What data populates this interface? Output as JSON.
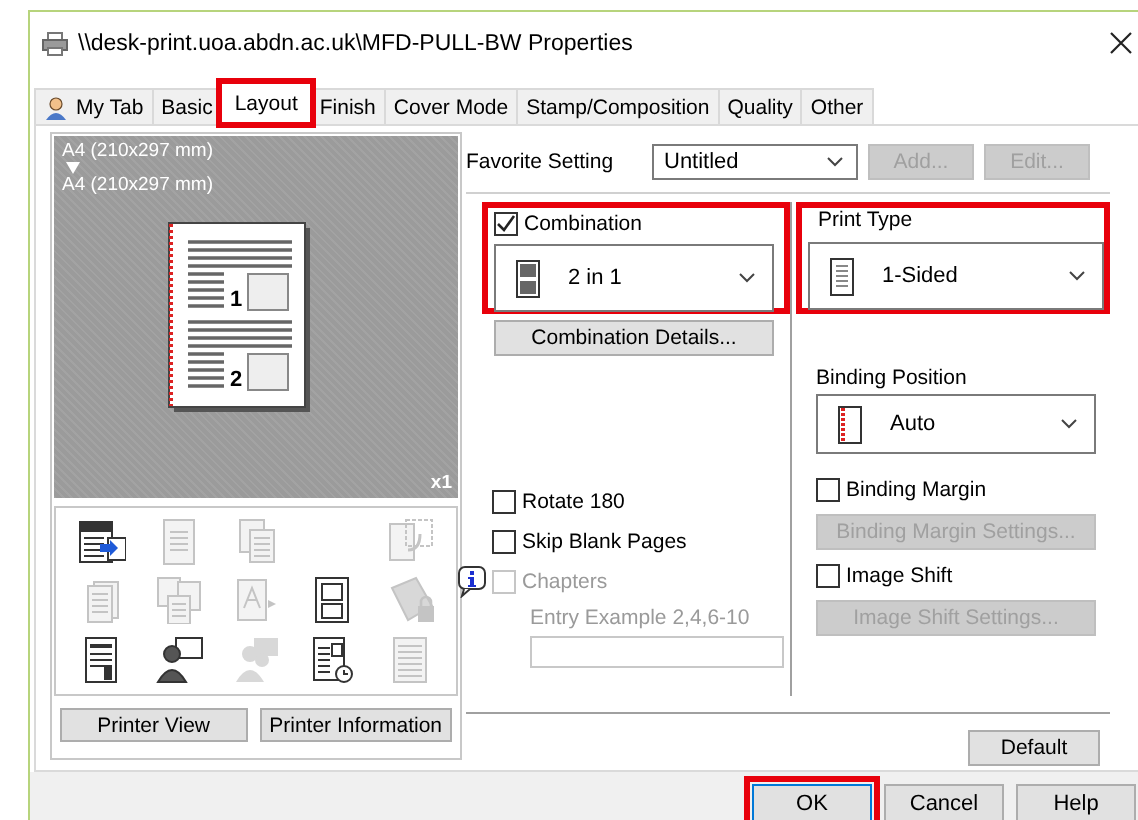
{
  "window": {
    "title": "\\\\desk-print.uoa.abdn.ac.uk\\MFD-PULL-BW Properties"
  },
  "tabs": [
    {
      "label": "My Tab",
      "has_icon": true,
      "selected": false,
      "highlighted": false
    },
    {
      "label": "Basic",
      "has_icon": false,
      "selected": false,
      "highlighted": false
    },
    {
      "label": "Layout",
      "has_icon": false,
      "selected": true,
      "highlighted": true
    },
    {
      "label": "Finish",
      "has_icon": false,
      "selected": false,
      "highlighted": false
    },
    {
      "label": "Cover Mode",
      "has_icon": false,
      "selected": false,
      "highlighted": false
    },
    {
      "label": "Stamp/Composition",
      "has_icon": false,
      "selected": false,
      "highlighted": false
    },
    {
      "label": "Quality",
      "has_icon": false,
      "selected": false,
      "highlighted": false
    },
    {
      "label": "Other",
      "has_icon": false,
      "selected": false,
      "highlighted": false
    }
  ],
  "preview": {
    "original_size": "A4 (210x297 mm)",
    "output_size": "A4 (210x297 mm)",
    "page_numbers": [
      "1",
      "2"
    ],
    "copies": "x1"
  },
  "function_icons": [
    {
      "kind": "device",
      "disabled": false
    },
    {
      "kind": "booklet",
      "disabled": true
    },
    {
      "kind": "pages",
      "disabled": true
    },
    {
      "kind": "spacer"
    },
    {
      "kind": "rotate",
      "disabled": true
    },
    {
      "kind": "stack",
      "disabled": true
    },
    {
      "kind": "multi",
      "disabled": true
    },
    {
      "kind": "font",
      "disabled": true
    },
    {
      "kind": "form",
      "disabled": false
    },
    {
      "kind": "lock",
      "disabled": true
    },
    {
      "kind": "report",
      "disabled": false
    },
    {
      "kind": "user",
      "disabled": false
    },
    {
      "kind": "users",
      "disabled": true
    },
    {
      "kind": "clock",
      "disabled": false
    },
    {
      "kind": "lines",
      "disabled": true
    }
  ],
  "preview_buttons": [
    {
      "label": "Printer View"
    },
    {
      "label": "Printer Information"
    }
  ],
  "favorite": {
    "label": "Favorite Setting",
    "value": "Untitled",
    "buttons": [
      {
        "label": "Add...",
        "disabled": true
      },
      {
        "label": "Edit...",
        "disabled": true
      }
    ]
  },
  "combination": {
    "label": "Combination",
    "checked": true,
    "highlighted": true,
    "value": "2 in 1",
    "details_button": {
      "label": "Combination Details...",
      "disabled": false
    }
  },
  "options": [
    {
      "label": "Rotate 180",
      "checked": false,
      "disabled": false,
      "has_info": false
    },
    {
      "label": "Skip Blank Pages",
      "checked": false,
      "disabled": false,
      "has_info": false
    },
    {
      "label": "Chapters",
      "checked": false,
      "disabled": true,
      "has_info": true
    }
  ],
  "chapters_hint": "Entry Example 2,4,6-10",
  "print_type": {
    "label": "Print Type",
    "value": "1-Sided",
    "highlighted": true
  },
  "binding_position": {
    "label": "Binding Position",
    "value": "Auto"
  },
  "settings": [
    {
      "label": "Binding Margin",
      "checked": false,
      "button": {
        "label": "Binding Margin Settings...",
        "disabled": true
      }
    },
    {
      "label": "Image Shift",
      "checked": false,
      "button": {
        "label": "Image Shift Settings...",
        "disabled": true
      }
    }
  ],
  "default_button": {
    "label": "Default"
  },
  "footer_buttons": [
    {
      "label": "OK",
      "highlighted": true
    },
    {
      "label": "Cancel",
      "highlighted": false
    },
    {
      "label": "Help",
      "highlighted": false
    }
  ]
}
